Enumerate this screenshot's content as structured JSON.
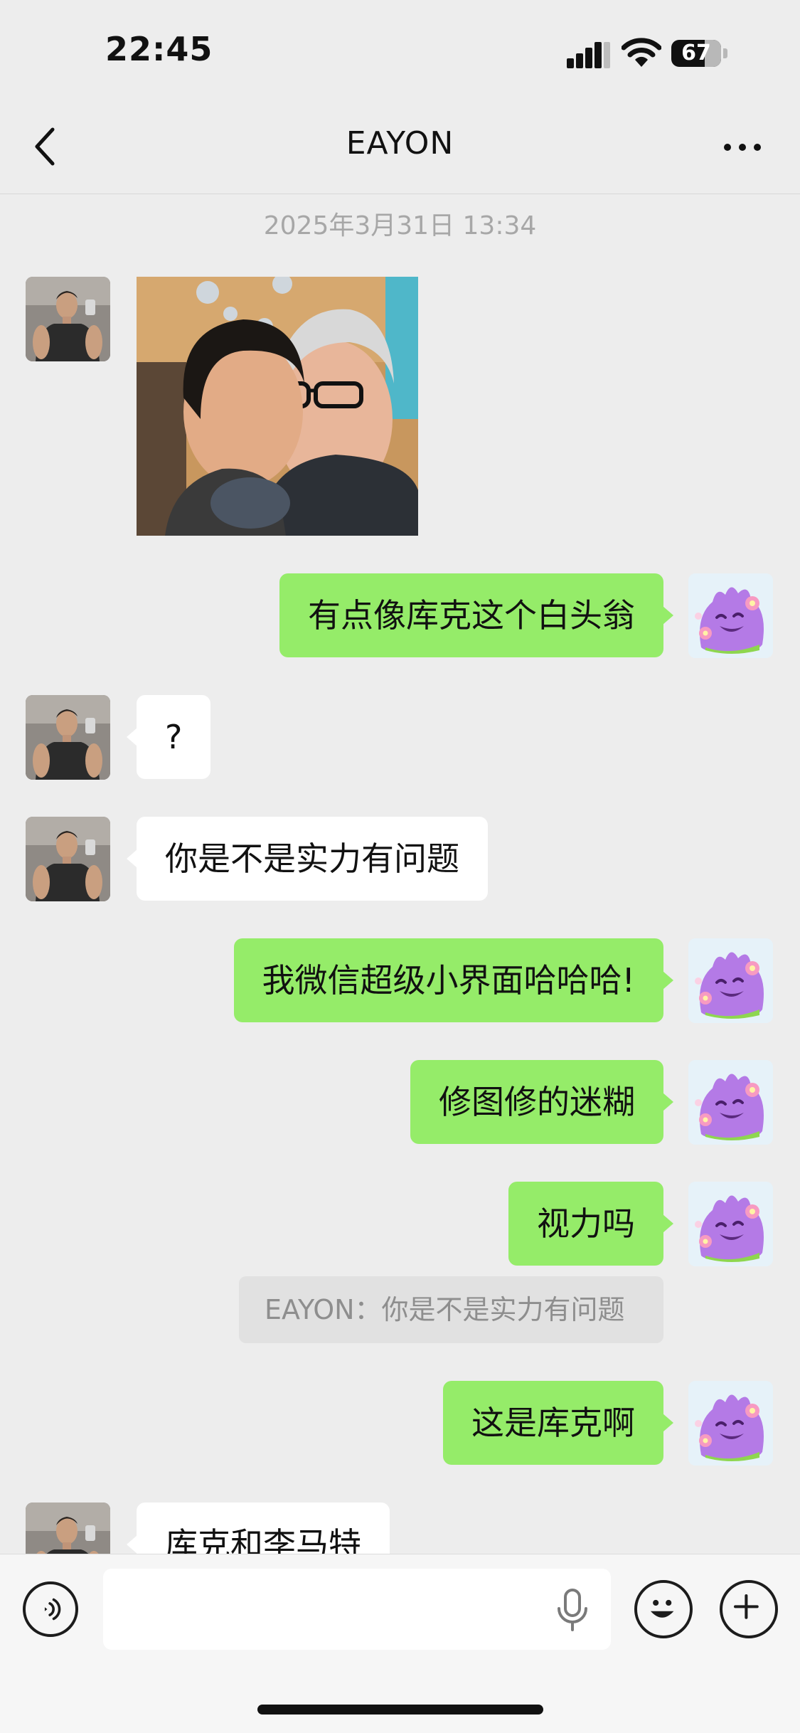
{
  "status_bar": {
    "time": "22:45",
    "battery_level": "67"
  },
  "nav": {
    "title": "EAYON"
  },
  "chat": {
    "timestamp": "2025年3月31日 13:34",
    "messages": [
      {
        "from": "other",
        "type": "image"
      },
      {
        "from": "me",
        "text": "有点像库克这个白头翁"
      },
      {
        "from": "other",
        "text": "?"
      },
      {
        "from": "other",
        "text": "你是不是实力有问题"
      },
      {
        "from": "me",
        "text": "我微信超级小界面哈哈哈!"
      },
      {
        "from": "me",
        "text": "修图修的迷糊"
      },
      {
        "from": "me",
        "text": "视力吗",
        "quote": "EAYON：你是不是实力有问题"
      },
      {
        "from": "me",
        "text": "这是库克啊"
      },
      {
        "from": "other",
        "text": "库克和李马特"
      }
    ]
  },
  "input_bar": {
    "value": ""
  },
  "colors": {
    "background": "#ededed",
    "outgoing_bubble": "#95ec69",
    "incoming_bubble": "#ffffff",
    "quote_bg": "#e1e1e1"
  }
}
